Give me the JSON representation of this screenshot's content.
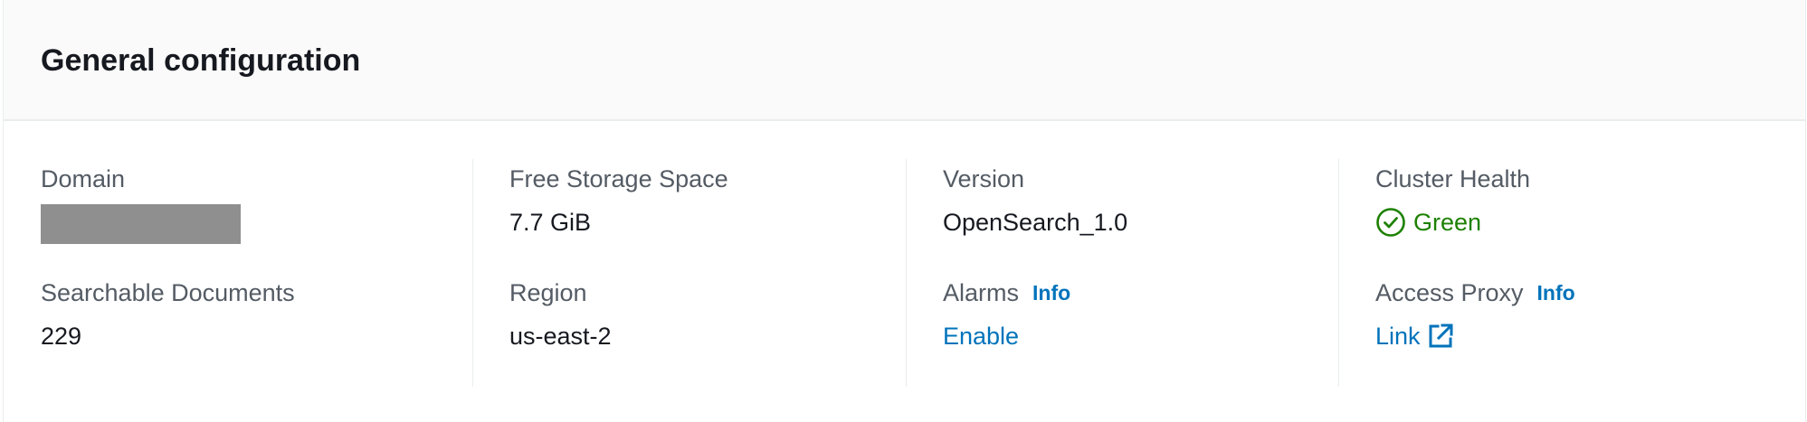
{
  "header": {
    "title": "General configuration"
  },
  "fields": {
    "domain": {
      "label": "Domain",
      "value_redacted": true
    },
    "searchable_documents": {
      "label": "Searchable Documents",
      "value": "229"
    },
    "free_storage_space": {
      "label": "Free Storage Space",
      "value": "7.7 GiB"
    },
    "region": {
      "label": "Region",
      "value": "us-east-2"
    },
    "version": {
      "label": "Version",
      "value": "OpenSearch_1.0"
    },
    "alarms": {
      "label": "Alarms",
      "info": "Info",
      "value": "Enable"
    },
    "cluster_health": {
      "label": "Cluster Health",
      "value": "Green",
      "icon": "check-circle-icon",
      "color": "#1d8102"
    },
    "access_proxy": {
      "label": "Access Proxy",
      "info": "Info",
      "value": "Link",
      "icon": "external-link-icon"
    }
  },
  "colors": {
    "link": "#0073bb",
    "label": "#545b64",
    "text": "#16191f",
    "success": "#1d8102",
    "header_bg": "#fafafa",
    "divider": "#eaeded",
    "redaction": "#8f8f8f"
  }
}
